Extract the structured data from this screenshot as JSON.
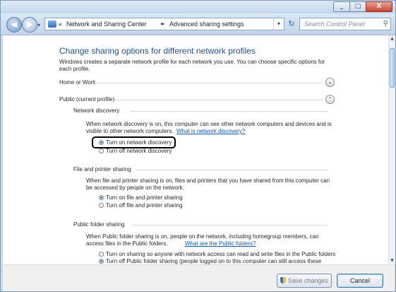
{
  "window": {
    "buttons": {
      "minimize": "_",
      "maximize": "□",
      "close": "X"
    }
  },
  "nav": {
    "back_icon": "left-arrow-icon",
    "forward_icon": "right-arrow-icon",
    "recent_icon": "chevron-down-icon",
    "breadcrumb": [
      "Network and Sharing Center",
      "Advanced sharing settings"
    ],
    "breadcrumb_prefix": "«",
    "separator": "►",
    "search_placeholder": "Search Control Panel"
  },
  "page": {
    "title": "Change sharing options for different network profiles",
    "intro": "Windows creates a separate network profile for each network you use. You can choose specific options for each profile.",
    "profiles": [
      {
        "label": "Home or Work",
        "expander": "⌄"
      },
      {
        "label": "Public (current profile)",
        "expander": "⌃"
      }
    ],
    "network_discovery": {
      "heading": "Network discovery",
      "description_line1": "When network discovery is on, this computer can see other network computers and devices and is",
      "description_line2": "visible to other network computers.",
      "link": "What is network discovery?",
      "options": [
        "Turn on network discovery",
        "Turn off network discovery"
      ],
      "selected_index": 0
    },
    "file_printer_sharing": {
      "heading": "File and printer sharing",
      "description_line1": "When file and printer sharing is on, files and printers that you have shared from this computer can",
      "description_line2": "be accessed by people on the network.",
      "options": [
        "Turn on file and printer sharing",
        "Turn off file and printer sharing"
      ],
      "selected_index": 0
    },
    "public_folder_sharing": {
      "heading": "Public folder sharing",
      "description_line1": "When Public folder sharing is on, people on the network, including homegroup members, can",
      "description_line2": "access files in the Public folders.",
      "link": "What are the Public folders?",
      "options": [
        "Turn on sharing so anyone with network access can read and write files in the Public folders",
        "Turn off Public folder sharing (people logged on to this computer can still access these"
      ],
      "selected_index": 1
    }
  },
  "footer": {
    "save_label": "Save changes",
    "cancel_label": "Cancel"
  }
}
